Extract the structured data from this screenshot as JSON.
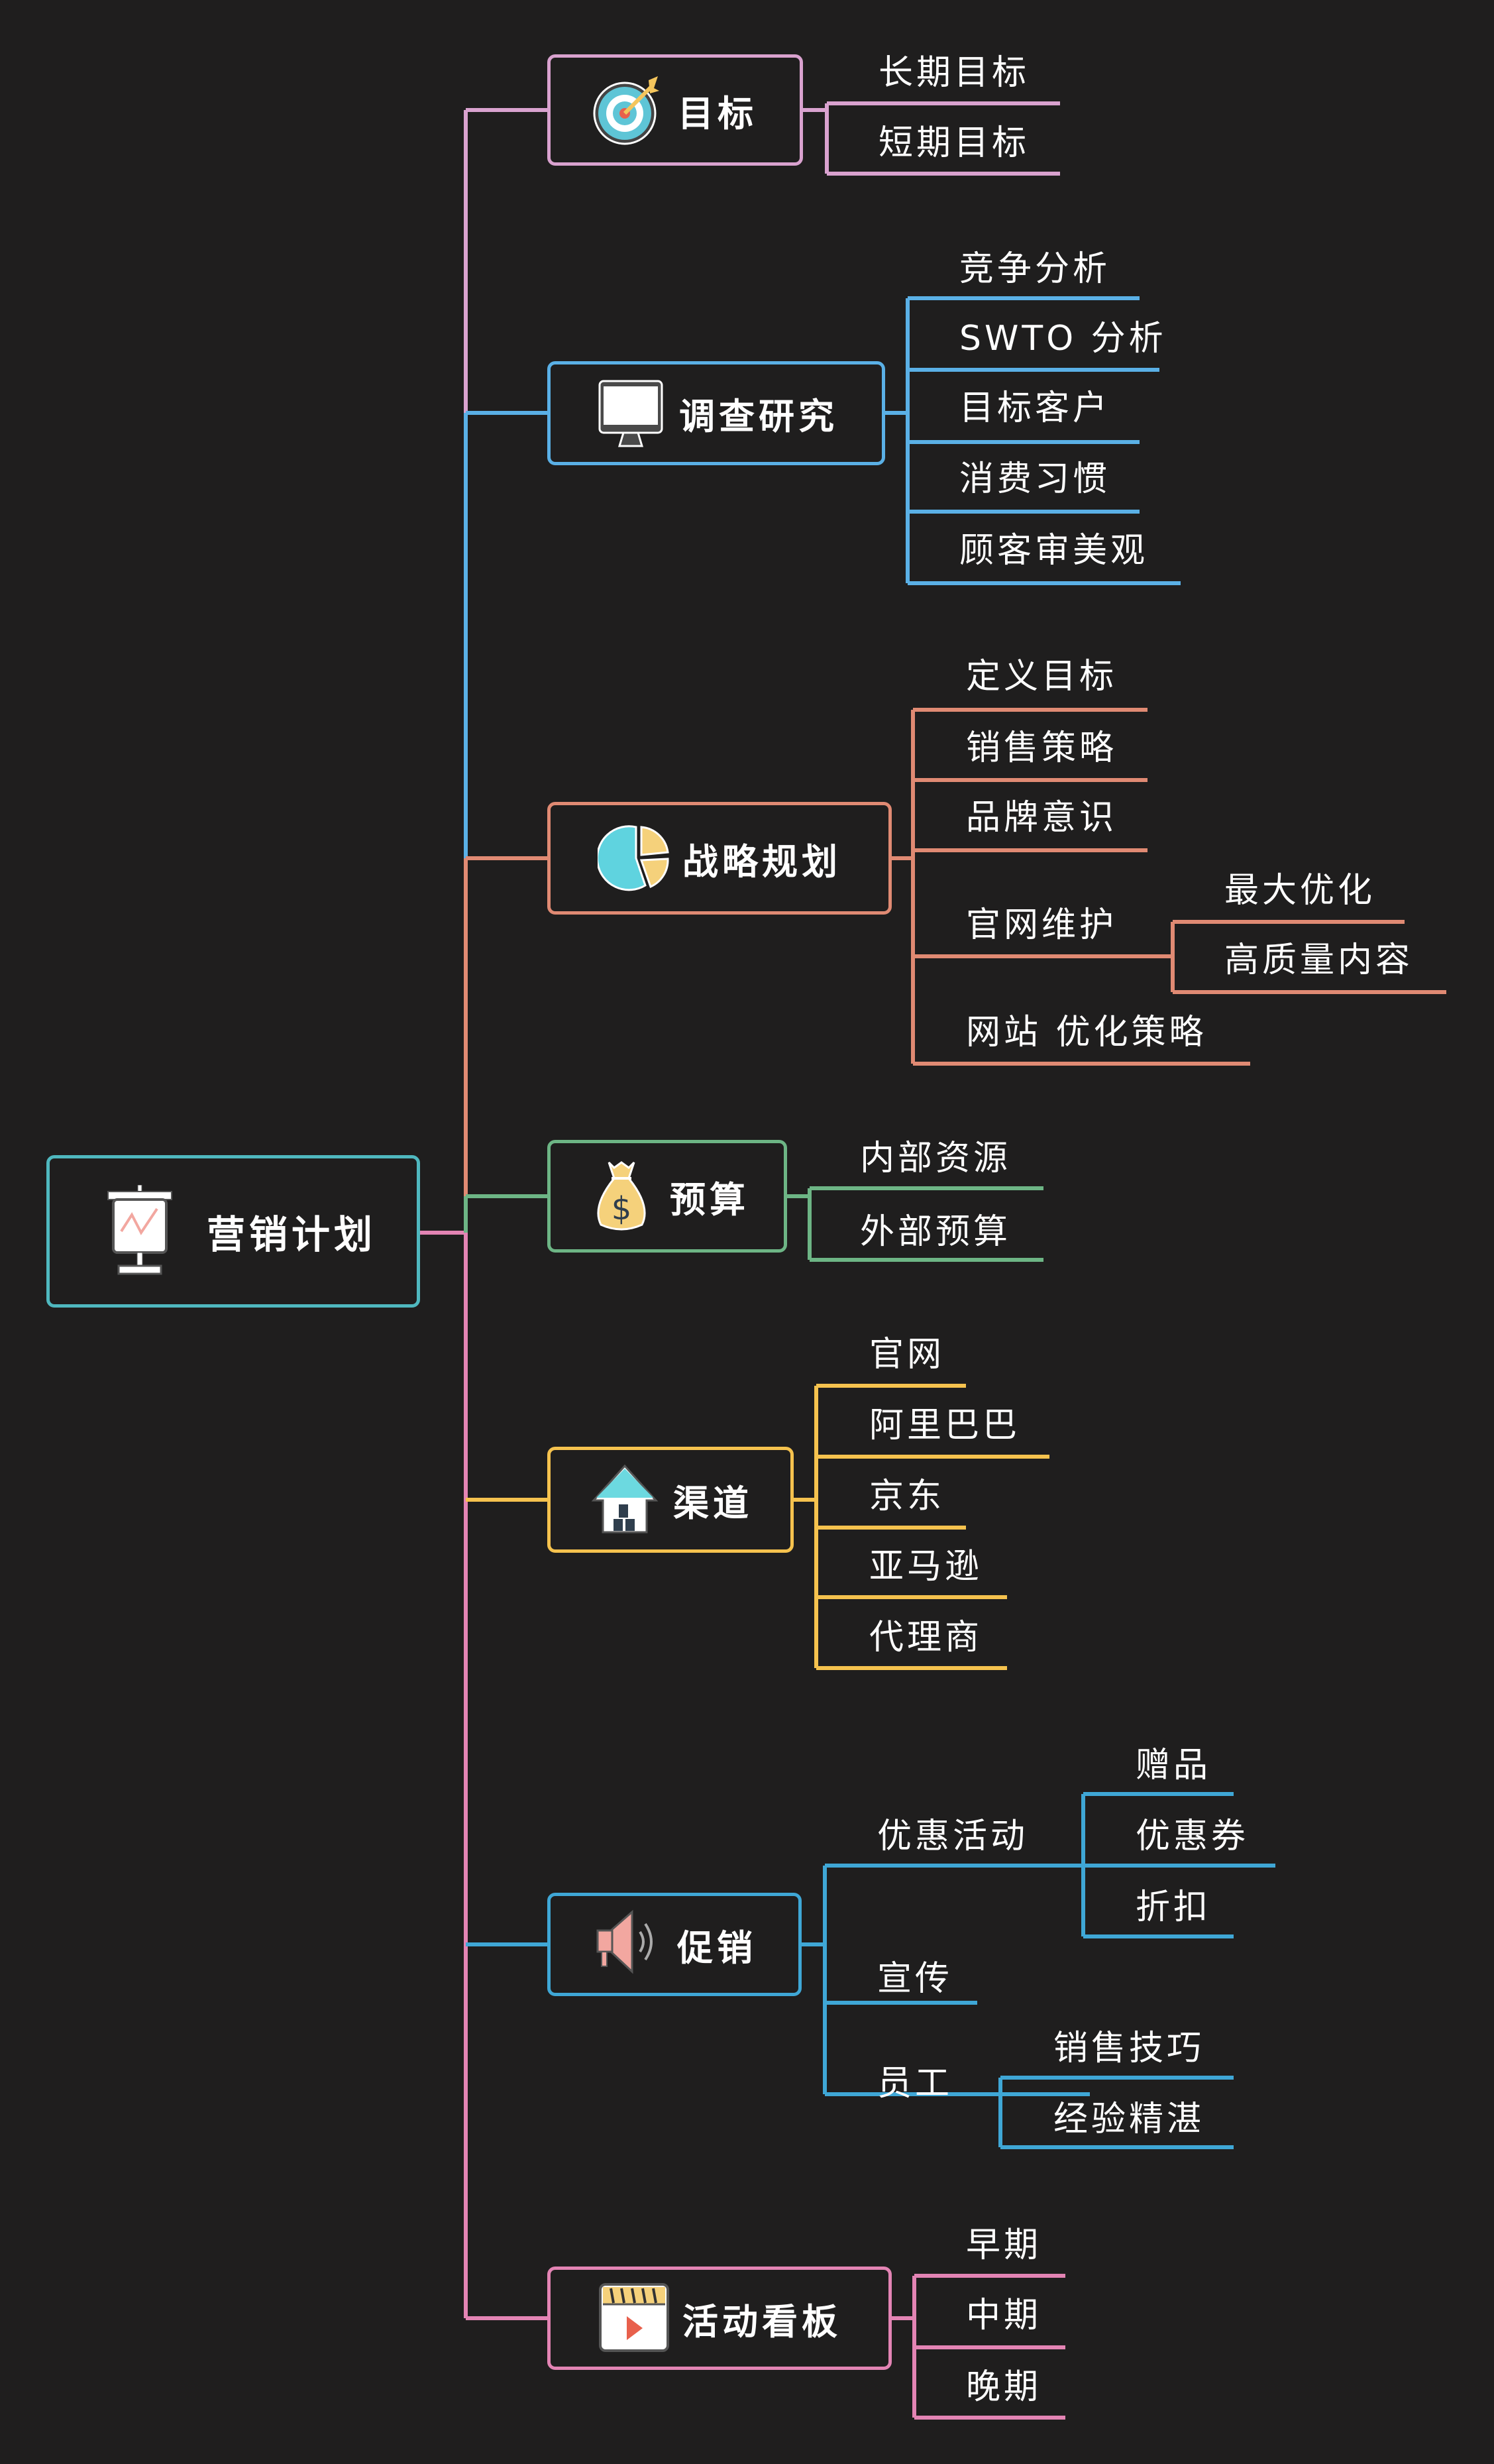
{
  "root": {
    "label": "营销计划",
    "icon": "presentation-chart-icon",
    "color": "#4fb8bf"
  },
  "branches": [
    {
      "id": "goal",
      "label": "目标",
      "icon": "target-icon",
      "color": "#d9a2cf",
      "children": [
        {
          "label": "长期目标"
        },
        {
          "label": "短期目标"
        }
      ]
    },
    {
      "id": "research",
      "label": "调查研究",
      "icon": "monitor-icon",
      "color": "#5ab0e6",
      "children": [
        {
          "label": "竞争分析"
        },
        {
          "label": "SWTO 分析"
        },
        {
          "label": "目标客户"
        },
        {
          "label": "消费习惯"
        },
        {
          "label": "顾客审美观"
        }
      ]
    },
    {
      "id": "strategy",
      "label": "战略规划",
      "icon": "pie-chart-icon",
      "color": "#e08a73",
      "children": [
        {
          "label": "定义目标"
        },
        {
          "label": "销售策略"
        },
        {
          "label": "品牌意识"
        },
        {
          "label": "官网维护",
          "children": [
            {
              "label": "最大优化"
            },
            {
              "label": "高质量内容"
            }
          ]
        },
        {
          "label": "网站 优化策略"
        }
      ]
    },
    {
      "id": "budget",
      "label": "预算",
      "icon": "money-bag-icon",
      "color": "#6db585",
      "children": [
        {
          "label": "内部资源"
        },
        {
          "label": "外部预算"
        }
      ]
    },
    {
      "id": "channel",
      "label": "渠道",
      "icon": "house-icon",
      "color": "#f5c24e",
      "children": [
        {
          "label": "官网"
        },
        {
          "label": "阿里巴巴"
        },
        {
          "label": "京东"
        },
        {
          "label": "亚马逊"
        },
        {
          "label": "代理商"
        }
      ]
    },
    {
      "id": "promotion",
      "label": "促销",
      "icon": "megaphone-icon",
      "color": "#3fa7d6",
      "children": [
        {
          "label": "优惠活动",
          "children": [
            {
              "label": "赠品"
            },
            {
              "label": "优惠券"
            },
            {
              "label": "折扣"
            }
          ]
        },
        {
          "label": "宣传"
        },
        {
          "label": "员工",
          "children": [
            {
              "label": "销售技巧"
            },
            {
              "label": "经验精湛"
            }
          ]
        }
      ]
    },
    {
      "id": "board",
      "label": "活动看板",
      "icon": "video-clapper-icon",
      "color": "#e384b4",
      "children": [
        {
          "label": "早期"
        },
        {
          "label": "中期"
        },
        {
          "label": "晚期"
        }
      ]
    }
  ]
}
